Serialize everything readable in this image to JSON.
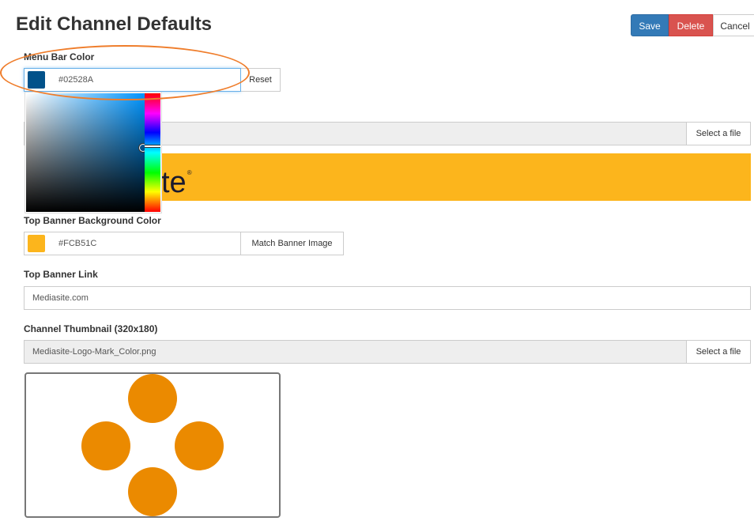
{
  "header": {
    "title": "Edit Channel Defaults",
    "save_label": "Save",
    "delete_label": "Delete",
    "cancel_label": "Cancel"
  },
  "menu_bar_color": {
    "label": "Menu Bar Color",
    "value": "#02528A",
    "swatch_color": "#02528A",
    "reset_label": "Reset"
  },
  "banner_image": {
    "select_label": "Select a file",
    "banner_text": "te",
    "banner_mark": "®",
    "banner_color": "#FCB51C"
  },
  "top_banner_bg": {
    "label": "Top Banner Background Color",
    "value": "#FCB51C",
    "swatch_color": "#FCB51C",
    "match_label": "Match Banner Image"
  },
  "top_banner_link": {
    "label": "Top Banner Link",
    "value": "Mediasite.com"
  },
  "channel_thumbnail": {
    "label": "Channel Thumbnail (320x180)",
    "file_name": "Mediasite-Logo-Mark_Color.png",
    "select_label": "Select a file",
    "dot_color": "#EB8A00"
  },
  "colors": {
    "highlight": "#EF7D2B",
    "primary": "#337AB7",
    "danger": "#D9534F"
  }
}
